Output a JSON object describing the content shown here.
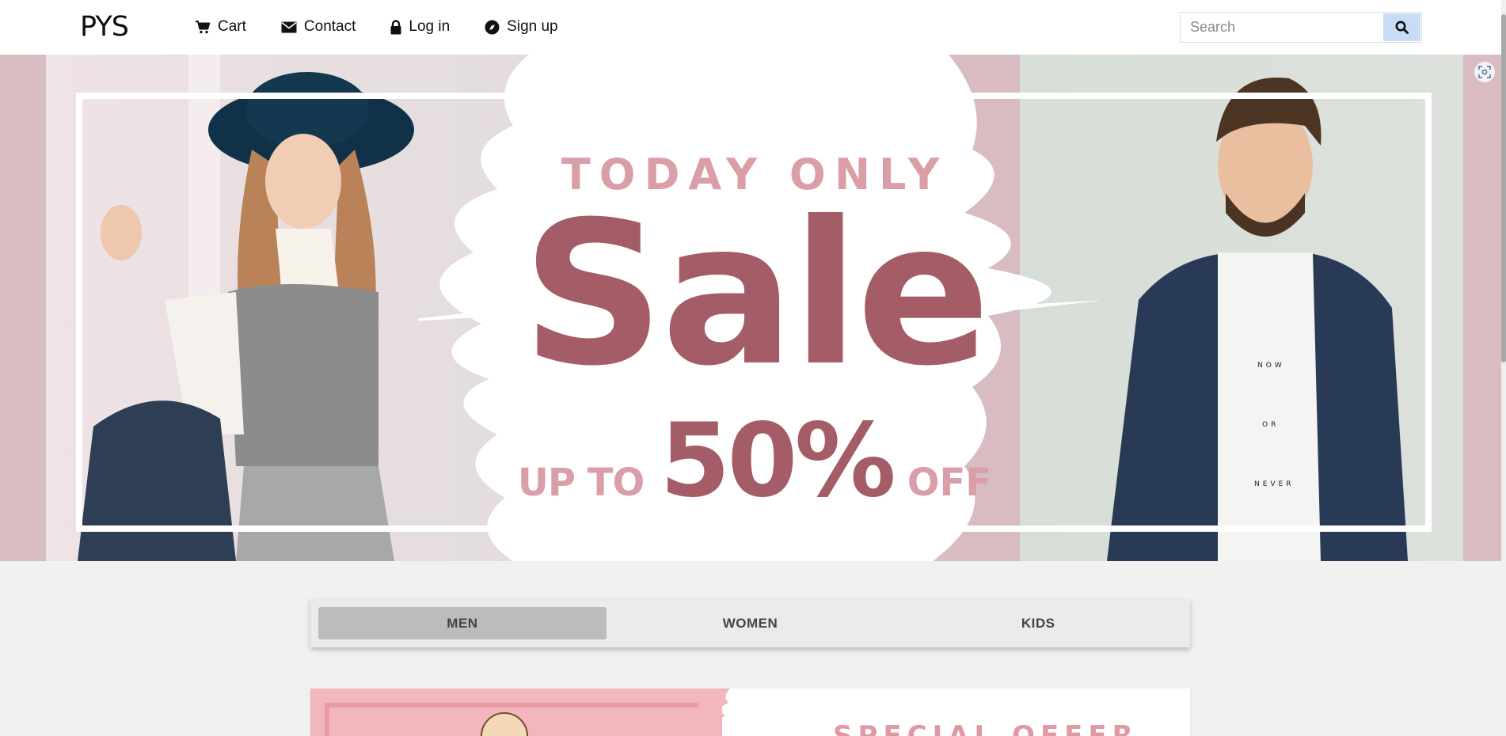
{
  "navbar": {
    "logo": "PYS",
    "links": [
      {
        "label": "Cart",
        "icon": "cart-icon"
      },
      {
        "label": "Contact",
        "icon": "envelope-icon"
      },
      {
        "label": "Log in",
        "icon": "lock-icon"
      },
      {
        "label": "Sign up",
        "icon": "compass-icon"
      }
    ],
    "search": {
      "placeholder": "Search",
      "value": "",
      "button_icon": "search-icon"
    }
  },
  "hero": {
    "eyebrow": "TODAY ONLY",
    "title": "Sale",
    "offer_prefix": "UP TO",
    "offer_value": "50%",
    "offer_suffix": "OFF",
    "colors": {
      "dark_rose": "#a45d66",
      "light_rose": "#d99ea6",
      "backdrop": "#d8bcc2"
    }
  },
  "tabs": [
    {
      "label": "MEN",
      "active": true
    },
    {
      "label": "WOMEN",
      "active": false
    },
    {
      "label": "KIDS",
      "active": false
    }
  ],
  "promo": {
    "title": "SPECIAL OFFER"
  },
  "overlay": {
    "screenshot_icon": "screenshot-capture-icon"
  }
}
